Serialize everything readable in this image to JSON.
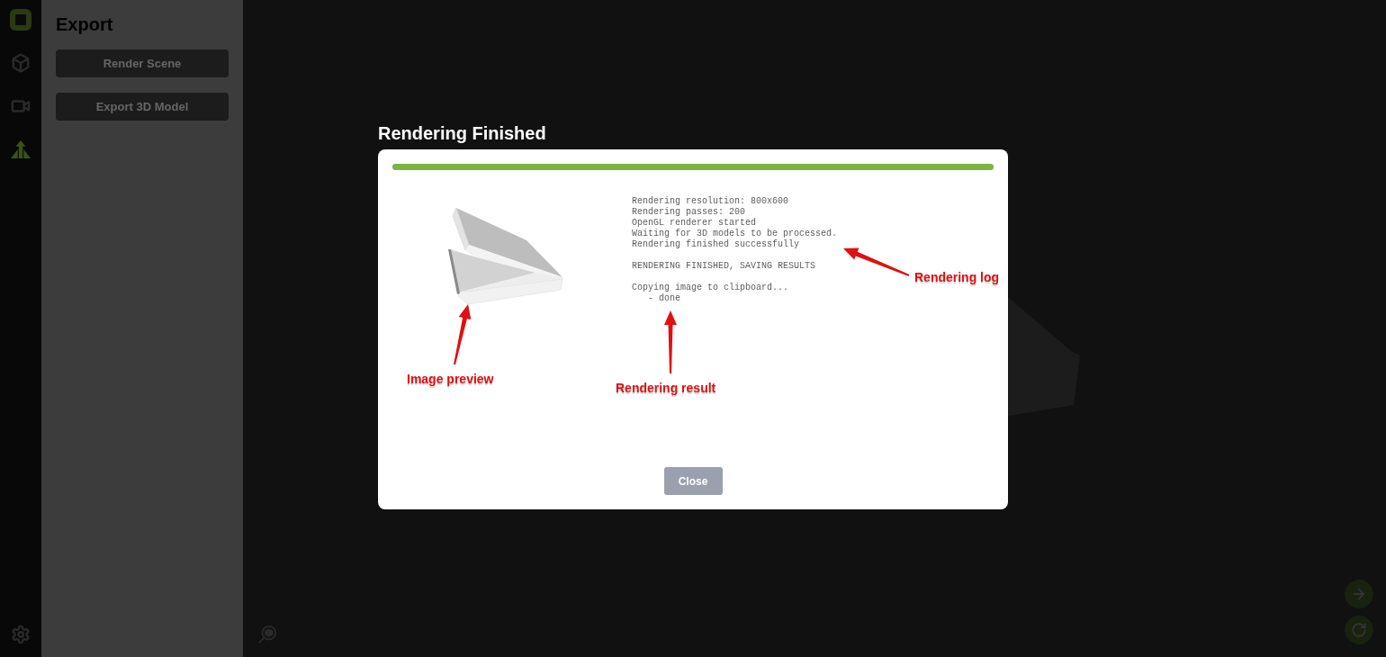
{
  "sidebar": {
    "items": [
      {
        "selected": false
      },
      {
        "selected": false
      },
      {
        "selected": true
      }
    ]
  },
  "panel": {
    "title": "Export",
    "buttons": [
      "Render Scene",
      "Export 3D Model"
    ]
  },
  "dialog": {
    "title": "Rendering Finished",
    "progress": {
      "level": 1
    },
    "log": [
      {
        "lines": [
          {
            "text": "Rendering resolution: 800x600"
          },
          {
            "text": "Rendering passes: 200"
          },
          {
            "text": "OpenGL renderer started"
          },
          {
            "text": "Waiting for 3D models to be processed."
          },
          {
            "text": "Rendering finished successfully"
          }
        ]
      },
      {
        "lines": [
          {
            "text": "RENDERING FINISHED, SAVING RESULTS"
          }
        ]
      },
      {
        "lines": [
          {
            "text": "Copying image to clipboard...",
            "children": [
              {
                "text": "- done"
              }
            ]
          }
        ]
      }
    ],
    "close_button": "Close"
  },
  "annotations": [
    {
      "text": "Image preview"
    },
    {
      "text": "Rendering result"
    },
    {
      "text": "Rendering log"
    }
  ]
}
